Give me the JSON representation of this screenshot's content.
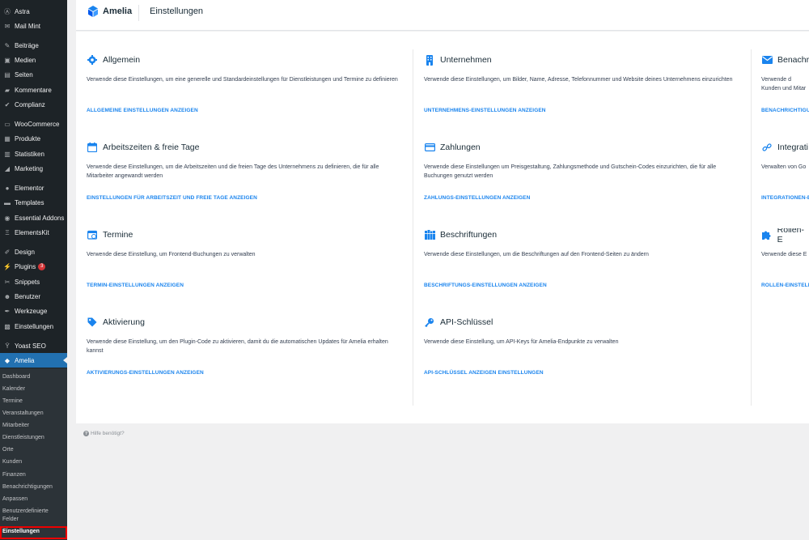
{
  "sidebar": {
    "items": [
      {
        "label": "Astra",
        "icon": "astra-icon"
      },
      {
        "label": "Mail Mint",
        "icon": "mail-icon"
      },
      {
        "label": "Beiträge",
        "icon": "pin-icon"
      },
      {
        "label": "Medien",
        "icon": "media-icon"
      },
      {
        "label": "Seiten",
        "icon": "page-icon"
      },
      {
        "label": "Kommentare",
        "icon": "comment-icon"
      },
      {
        "label": "Complianz",
        "icon": "check-icon"
      },
      {
        "label": "WooCommerce",
        "icon": "woo-icon"
      },
      {
        "label": "Produkte",
        "icon": "archive-icon"
      },
      {
        "label": "Statistiken",
        "icon": "chart-icon"
      },
      {
        "label": "Marketing",
        "icon": "megaphone-icon"
      },
      {
        "label": "Elementor",
        "icon": "elementor-icon"
      },
      {
        "label": "Templates",
        "icon": "folder-icon"
      },
      {
        "label": "Essential Addons",
        "icon": "ea-icon"
      },
      {
        "label": "ElementsKit",
        "icon": "ekit-icon"
      },
      {
        "label": "Design",
        "icon": "brush-icon"
      },
      {
        "label": "Plugins",
        "icon": "plugin-icon",
        "badge": "3"
      },
      {
        "label": "Snippets",
        "icon": "code-icon"
      },
      {
        "label": "Benutzer",
        "icon": "user-icon"
      },
      {
        "label": "Werkzeuge",
        "icon": "wrench-icon"
      },
      {
        "label": "Einstellungen",
        "icon": "settings-icon"
      },
      {
        "label": "Yoast SEO",
        "icon": "yoast-icon"
      },
      {
        "label": "Amelia",
        "icon": "amelia-icon"
      }
    ],
    "submenu": [
      "Dashboard",
      "Kalender",
      "Termine",
      "Veranstaltungen",
      "Mitarbeiter",
      "Dienstleistungen",
      "Orte",
      "Kunden",
      "Finanzen",
      "Benachrichtigungen",
      "Anpassen",
      "Benutzerdefinierte Felder",
      "Einstellungen"
    ]
  },
  "header": {
    "logo_text": "Amelia",
    "title": "Einstellungen"
  },
  "cards": [
    {
      "title": "Allgemein",
      "icon": "gear-icon",
      "desc": "Verwende diese Einstellungen, um eine generelle und Standardeinstellungen für Dienstleistungen und Termine zu definieren",
      "link": "ALLGEMEINE EINSTELLUNGEN ANZEIGEN"
    },
    {
      "title": "Unternehmen",
      "icon": "building-icon",
      "desc": "Verwende diese Einstellungen, um Bilder, Name, Adresse, Telefonnummer und Website deines Unternehmens einzurichten",
      "link": "UNTERNEHMENS-EINSTELLUNGEN ANZEIGEN"
    },
    {
      "title": "Benachr",
      "icon": "envelope-icon",
      "desc": "Verwende d Kunden und Mitar",
      "link": "BENACHRICHTIGU"
    },
    {
      "title": "Arbeitszeiten & freie Tage",
      "icon": "calendar-icon",
      "desc": "Verwende diese Einstellungen, um die Arbeitszeiten und die freien Tage des Unternehmens zu definieren, die für alle Mitarbeiter angewandt werden",
      "link": "EINSTELLUNGEN FÜR ARBEITSZEIT UND FREIE TAGE ANZEIGEN"
    },
    {
      "title": "Zahlungen",
      "icon": "credit-card-icon",
      "desc": "Verwende diese Einstellungen um Preisgestaltung, Zahlungsmethode und Gutschein-Codes einzurichten, die für alle Buchungen genutzt werden",
      "link": "ZAHLUNGS-EINSTELLUNGEN ANZEIGEN"
    },
    {
      "title": "Integrati",
      "icon": "link-icon",
      "desc": "Verwalten von Go",
      "link": "INTEGRATIONEN-E"
    },
    {
      "title": "Termine",
      "icon": "appointment-icon",
      "desc": "Verwende diese Einstellung, um Frontend-Buchungen zu verwalten",
      "link": "TERMIN-EINSTELLUNGEN ANZEIGEN"
    },
    {
      "title": "Beschriftungen",
      "icon": "books-icon",
      "desc": "Verwende diese Einstellungen, um die Beschriftungen auf den Frontend-Seiten zu ändern",
      "link": "BESCHRIFTUNGS-EINSTELLUNGEN ANZEIGEN"
    },
    {
      "title": "Rollen-E",
      "icon": "puzzle-icon",
      "desc": "Verwende diese E",
      "link": "ROLLEN-EINSTELL"
    },
    {
      "title": "Aktivierung",
      "icon": "tag-icon",
      "desc": "Verwende diese Einstellung, um den Plugin-Code zu aktivieren, damit du die automatischen Updates für Amelia erhalten kannst",
      "link": "AKTIVIERUNGS-EINSTELLUNGEN ANZEIGEN"
    },
    {
      "title": "API-Schlüssel",
      "icon": "key-icon",
      "desc": "Verwende diese Einstellung, um API-Keys für Amelia-Endpunkte zu verwalten",
      "link": "API-SCHLÜSSEL ANZEIGEN EINSTELLUNGEN"
    }
  ],
  "help": {
    "label": "Hilfe benötigt?"
  },
  "colors": {
    "accent": "#1a84ee",
    "sidebar": "#1d2327",
    "current": "#2271b1"
  }
}
